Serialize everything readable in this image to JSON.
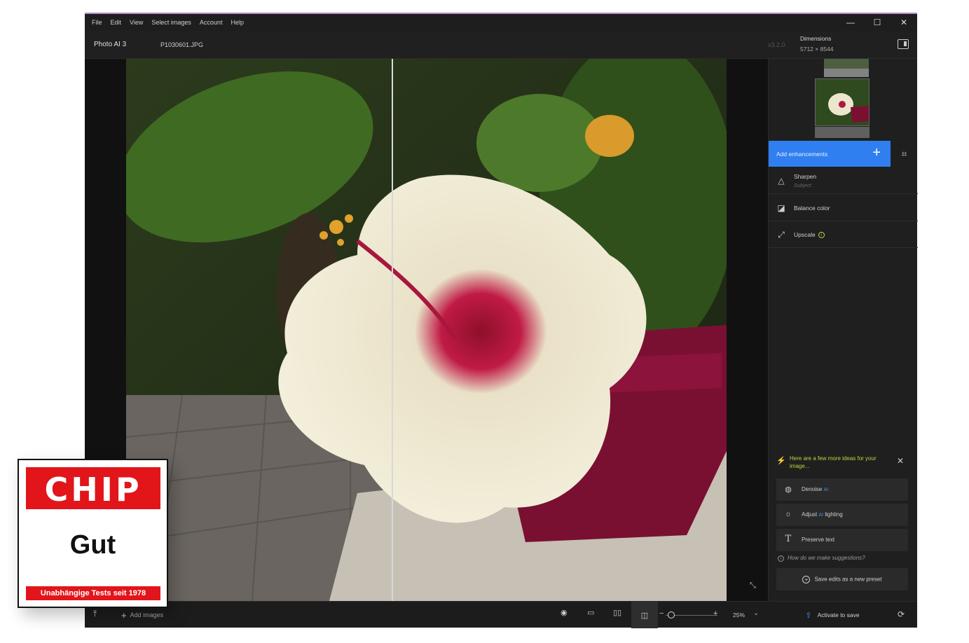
{
  "menu": [
    "File",
    "Edit",
    "View",
    "Select images",
    "Account",
    "Help"
  ],
  "window_controls": {
    "minimize": "—",
    "maximize": "☐",
    "close": "✕"
  },
  "header": {
    "app_name": "Photo AI 3",
    "file_name": "P1030601.JPG",
    "version": "v3.2.0",
    "dimensions_label": "Dimensions",
    "dimensions_value": "5712 × 8544"
  },
  "sidebar": {
    "add_enhancements": "Add enhancements",
    "enhancements": [
      {
        "label": "Sharpen",
        "sub": "Subject",
        "icon": "triangle-icon"
      },
      {
        "label": "Balance color",
        "sub": "",
        "icon": "balance-color-icon"
      },
      {
        "label": "Upscale",
        "sub": "",
        "icon": "upscale-icon"
      }
    ],
    "ideas_text": "Here are a few more ideas for your image...",
    "suggestions": [
      {
        "pre": "Denoise",
        "ai": "AI",
        "post": "",
        "icon": "globe-icon"
      },
      {
        "pre": "Adjust",
        "ai": "AI",
        "post": "lighting",
        "icon": "sun-icon"
      },
      {
        "pre": "Preserve text",
        "ai": "",
        "post": "",
        "icon": "text-icon"
      }
    ],
    "how_link": "How do we make suggestions?",
    "save_preset": "Save edits as a new preset"
  },
  "bottombar": {
    "add_images": "Add images",
    "zoom": "25%",
    "activate": "Activate to save",
    "zoom_level": 0.05
  },
  "chip": {
    "brand": "CHIP",
    "rating": "Gut",
    "tagline": "Unabhängige Tests seit 1978"
  },
  "colors": {
    "accent": "#2f7ff0",
    "ideas": "#c4d33a",
    "chip_red": "#e1151a"
  }
}
